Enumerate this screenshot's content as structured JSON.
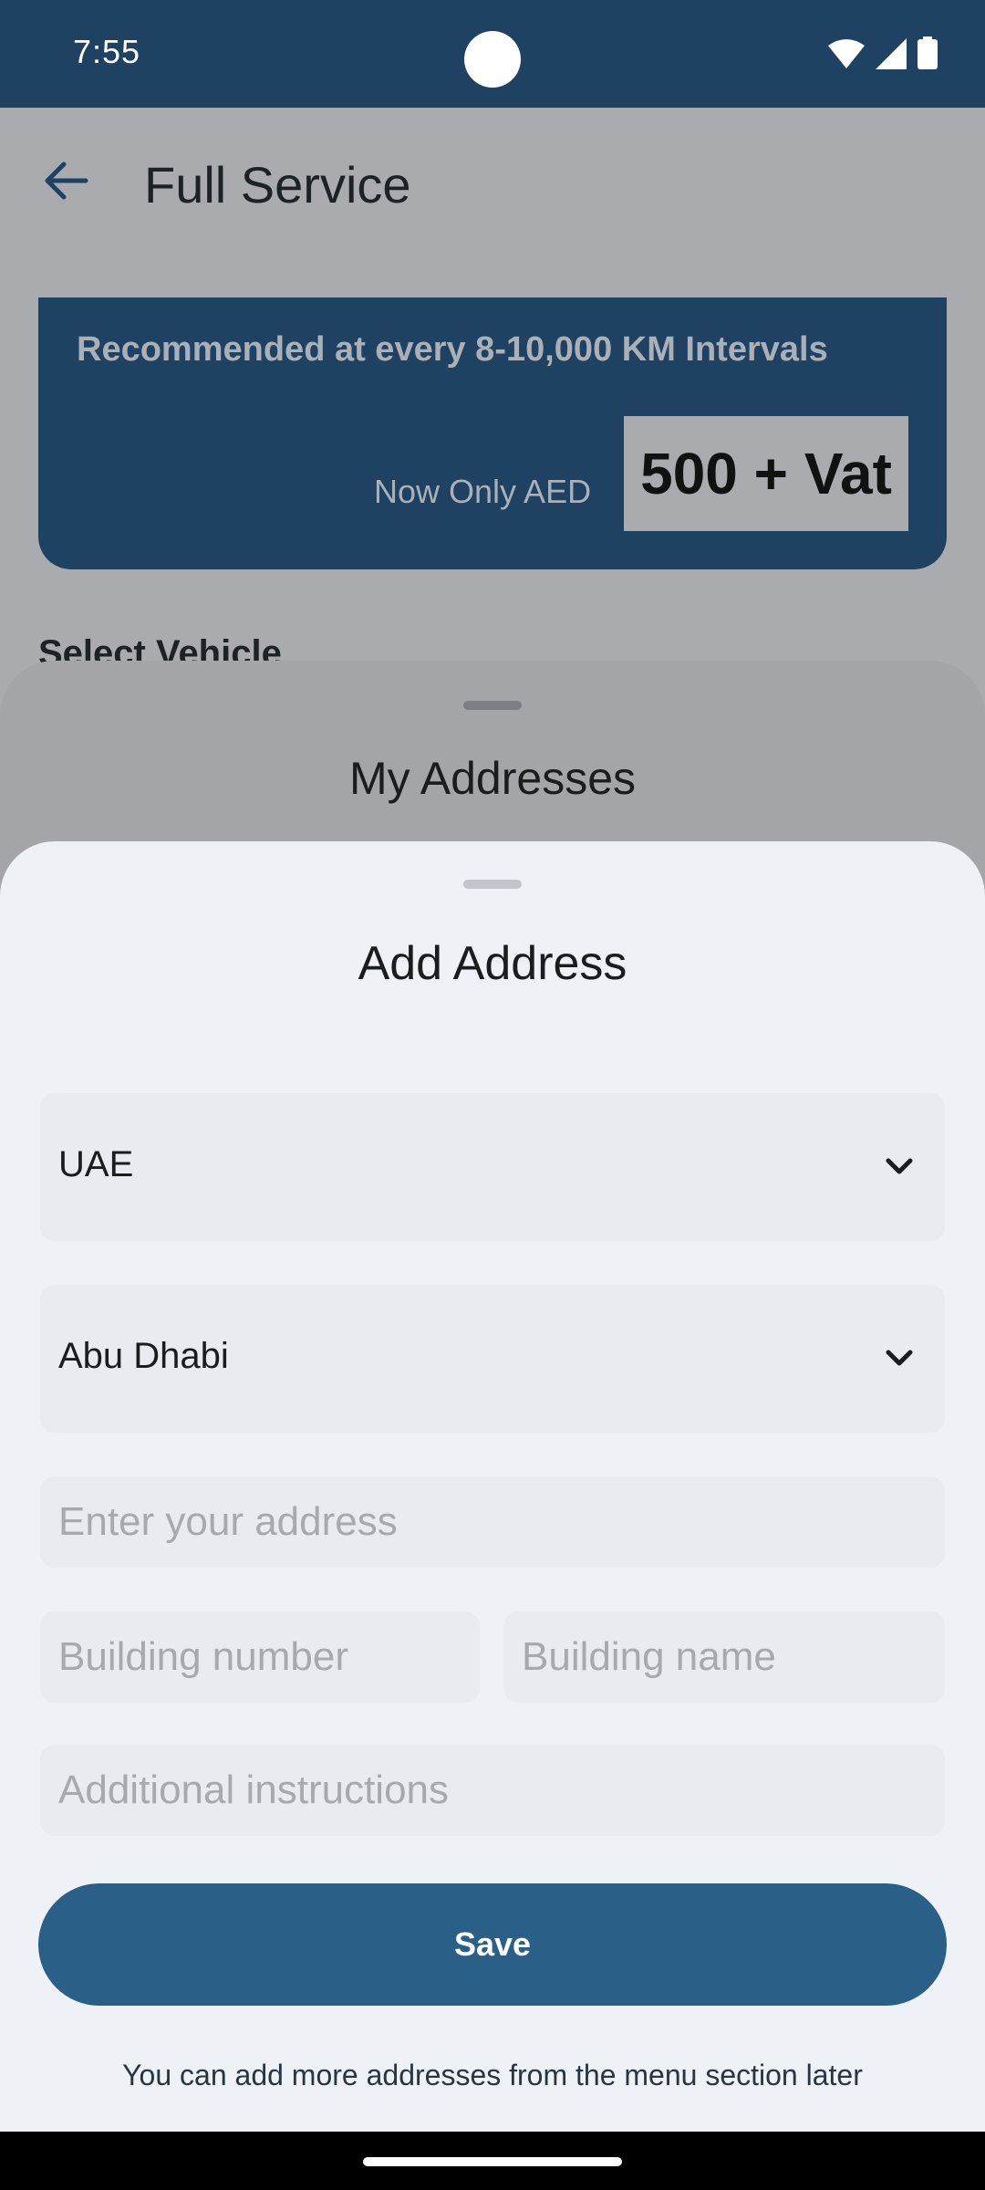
{
  "status_bar": {
    "time": "7:55",
    "icons": [
      "wifi-icon",
      "signal-icon",
      "battery-icon"
    ]
  },
  "app_bar": {
    "title": "Full Service",
    "back_icon": "arrow-left-icon"
  },
  "promo": {
    "heading": "Recommended at every 8-10,000 KM Intervals",
    "label": "Now Only AED",
    "price": "500 + Vat"
  },
  "section": {
    "select_vehicle": "Select Vehicle"
  },
  "addresses_sheet": {
    "title": "My Addresses"
  },
  "add_address_sheet": {
    "title": "Add Address",
    "country": {
      "value": "UAE",
      "icon": "chevron-down-icon"
    },
    "city": {
      "value": "Abu Dhabi",
      "icon": "chevron-down-icon"
    },
    "address_placeholder": "Enter your address",
    "building_number_placeholder": "Building number",
    "building_name_placeholder": "Building name",
    "instructions_placeholder": "Additional instructions",
    "save_label": "Save",
    "footer_note": "You can add more addresses from the menu section later"
  },
  "colors": {
    "primary": "#1f4162",
    "button": "#2a5f87",
    "sheet_bg": "#eef1f6",
    "field_bg": "#e8ebf0"
  }
}
